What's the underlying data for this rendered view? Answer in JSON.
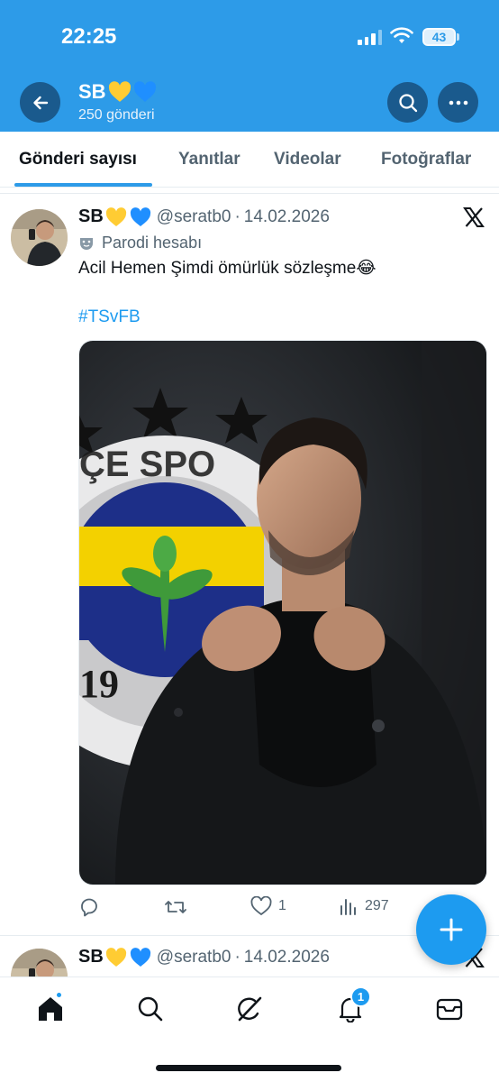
{
  "status_bar": {
    "time": "22:25",
    "battery": "43"
  },
  "header": {
    "name": "SB",
    "post_count": "250 gönderi"
  },
  "tabs": [
    {
      "label": "Gönderi sayısı",
      "active": true
    },
    {
      "label": "Yanıtlar",
      "active": false
    },
    {
      "label": "Videolar",
      "active": false
    },
    {
      "label": "Fotoğraflar",
      "active": false
    }
  ],
  "post": {
    "author": "SB",
    "handle": "@seratb0",
    "date": "14.02.2026",
    "parody_label": "Parodi hesabı",
    "text": "Acil Hemen Şimdi ömürlük sözleşme😂",
    "hashtag": "#TSvFB",
    "actions": {
      "replies": "",
      "reposts": "",
      "likes": "1",
      "views": "297"
    }
  },
  "next_post": {
    "author": "SB",
    "handle": "@seratb0",
    "date": "14.02.2026"
  },
  "bottom_nav": {
    "notifications_badge": "1"
  },
  "icons": [
    "back-arrow-icon",
    "search-icon",
    "more-icon",
    "x-logo-icon",
    "parody-mask-icon",
    "reply-icon",
    "repost-icon",
    "like-icon",
    "views-icon",
    "compose-plus-icon",
    "home-icon",
    "explore-icon",
    "grok-icon",
    "bell-icon",
    "mail-icon"
  ],
  "colors": {
    "header_bg": "#2d9be8",
    "accent": "#1d9bf0",
    "text": "#0f1419",
    "muted": "#536471"
  }
}
